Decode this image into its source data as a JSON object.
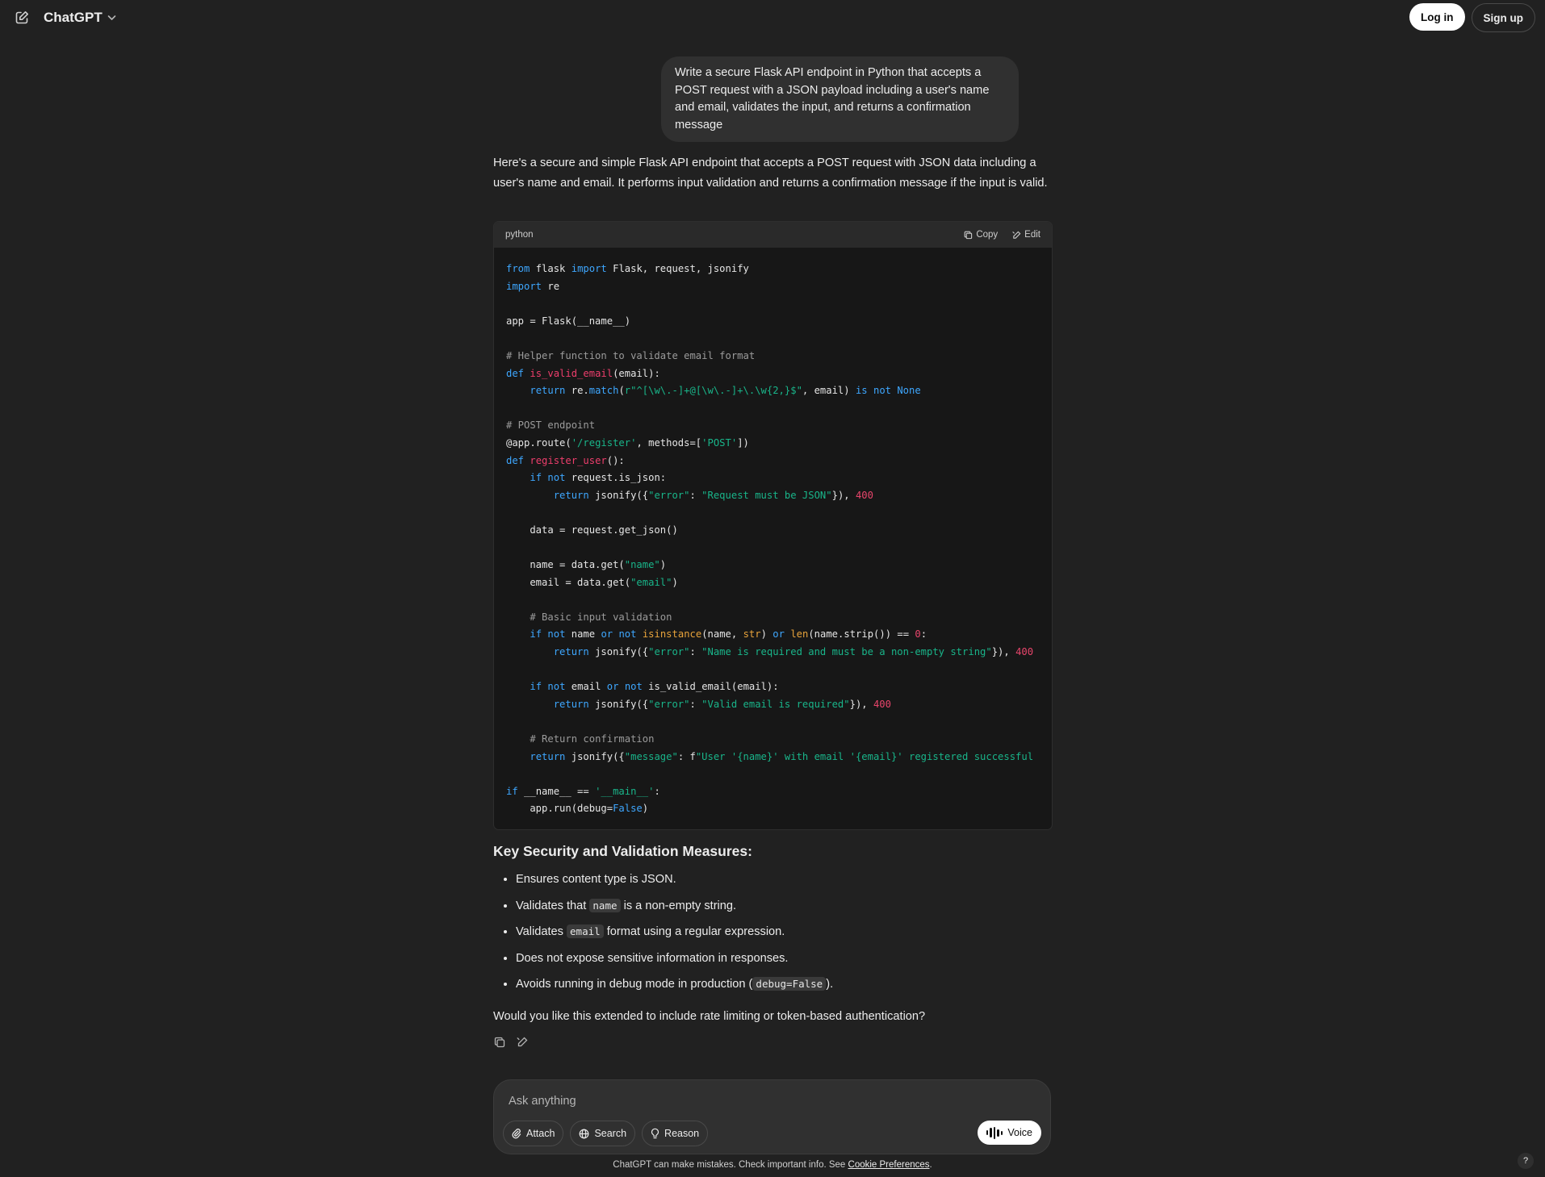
{
  "header": {
    "brand": "ChatGPT",
    "login": "Log in",
    "signup": "Sign up"
  },
  "conversation": {
    "user_message": "Write a secure Flask API endpoint in Python that accepts a POST request with a JSON payload including a user's name and email, validates the input, and returns a confirmation message",
    "intro": "Here's a secure and simple Flask API endpoint that accepts a POST request with JSON data including a user's name and email. It performs input validation and returns a confirmation message if the input is valid.",
    "code": {
      "language": "python",
      "copy_label": "Copy",
      "edit_label": "Edit",
      "lines": [
        "from flask import Flask, request, jsonify",
        "import re",
        "",
        "app = Flask(__name__)",
        "",
        "# Helper function to validate email format",
        "def is_valid_email(email):",
        "    return re.match(r\"^[\\w\\.-]+@[\\w\\.-]+\\.\\w{2,}$\", email) is not None",
        "",
        "# POST endpoint",
        "@app.route('/register', methods=['POST'])",
        "def register_user():",
        "    if not request.is_json:",
        "        return jsonify({\"error\": \"Request must be JSON\"}), 400",
        "",
        "    data = request.get_json()",
        "",
        "    name = data.get(\"name\")",
        "    email = data.get(\"email\")",
        "",
        "    # Basic input validation",
        "    if not name or not isinstance(name, str) or len(name.strip()) == 0:",
        "        return jsonify({\"error\": \"Name is required and must be a non-empty string\"}), 400",
        "",
        "    if not email or not is_valid_email(email):",
        "        return jsonify({\"error\": \"Valid email is required\"}), 400",
        "",
        "    # Return confirmation",
        "    return jsonify({\"message\": f\"User '{name}' with email '{email}' registered successful",
        "",
        "if __name__ == '__main__':",
        "    app.run(debug=False)"
      ]
    },
    "heading": "Key Security and Validation Measures:",
    "points": [
      {
        "before": "Ensures content type is JSON.",
        "code": "",
        "after": ""
      },
      {
        "before": "Validates that ",
        "code": "name",
        "after": " is a non-empty string."
      },
      {
        "before": "Validates ",
        "code": "email",
        "after": " format using a regular expression."
      },
      {
        "before": "Does not expose sensitive information in responses.",
        "code": "",
        "after": ""
      },
      {
        "before": "Avoids running in debug mode in production (",
        "code": "debug=False",
        "after": ")."
      }
    ],
    "question": "Would you like this extended to include rate limiting or token-based authentication?"
  },
  "composer": {
    "placeholder": "Ask anything",
    "attach": "Attach",
    "search": "Search",
    "reason": "Reason",
    "voice": "Voice"
  },
  "footer": {
    "text": "ChatGPT can make mistakes. Check important info. See ",
    "link": "Cookie Preferences",
    "end": ".",
    "help": "?"
  },
  "icons": {
    "new_chat": "new-chat-icon",
    "chevron": "chevron-down-icon",
    "copy": "copy-icon",
    "edit": "edit-icon",
    "attach": "paperclip-icon",
    "search": "globe-icon",
    "reason": "lightbulb-icon",
    "voice": "voice-bars-icon"
  }
}
